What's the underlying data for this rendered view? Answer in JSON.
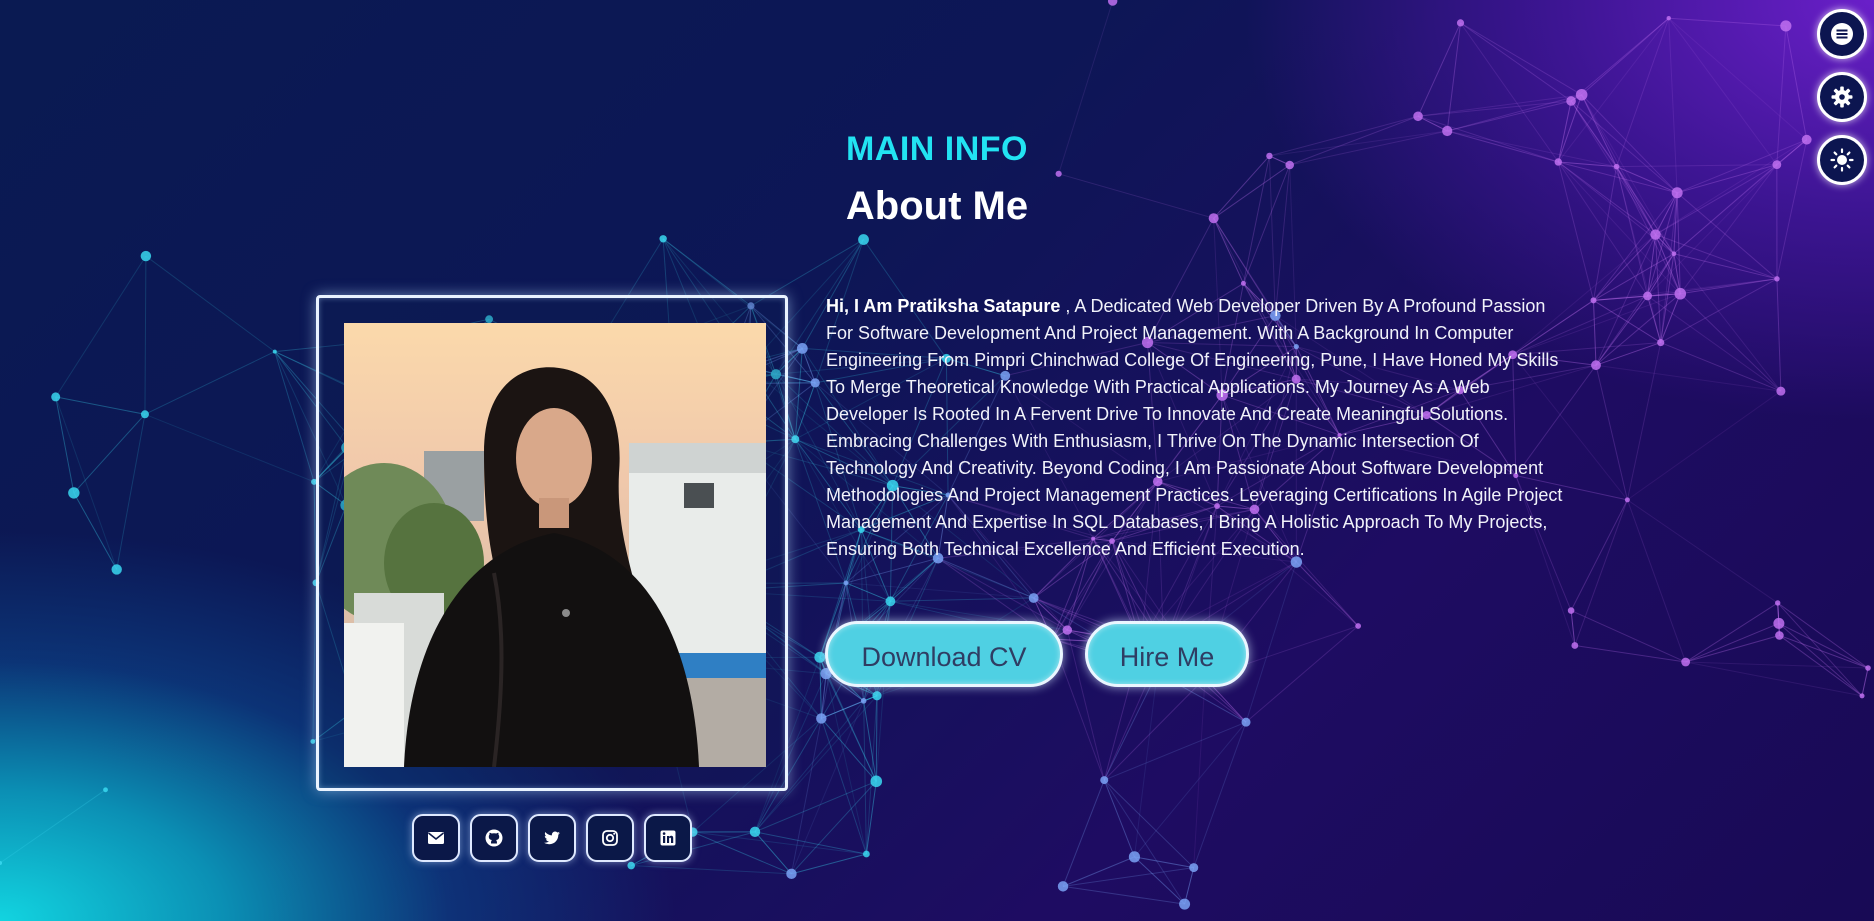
{
  "section": {
    "subtitle": "MAIN INFO",
    "title": "About Me"
  },
  "about": {
    "greeting": "Hi, I Am Pratiksha Satapure",
    "bio": " , A Dedicated Web Developer Driven By A Profound Passion For Software Development And Project Management. With A Background In Computer Engineering From Pimpri Chinchwad College Of Engineering, Pune, I Have Honed My Skills To Merge Theoretical Knowledge With Practical Applications. My Journey As A Web Developer Is Rooted In A Fervent Drive To Innovate And Create Meaningful Solutions. Embracing Challenges With Enthusiasm, I Thrive On The Dynamic Intersection Of Technology And Creativity. Beyond Coding, I Am Passionate About Software Development Methodologies And Project Management Practices. Leveraging Certifications In Agile Project Management And Expertise In SQL Databases, I Bring A Holistic Approach To My Projects, Ensuring Both Technical Excellence And Efficient Execution."
  },
  "buttons": {
    "download_cv": "Download CV",
    "hire_me": "Hire Me"
  },
  "socials": [
    {
      "icon": "envelope-icon"
    },
    {
      "icon": "github-icon"
    },
    {
      "icon": "twitter-icon"
    },
    {
      "icon": "instagram-icon"
    },
    {
      "icon": "linkedin-icon"
    }
  ],
  "side_controls": [
    {
      "icon": "menu-icon"
    },
    {
      "icon": "settings-gear-icon"
    },
    {
      "icon": "theme-sun-icon"
    }
  ],
  "colors": {
    "accent": "#22e3f2",
    "button_bg": "#4fd0e3"
  }
}
